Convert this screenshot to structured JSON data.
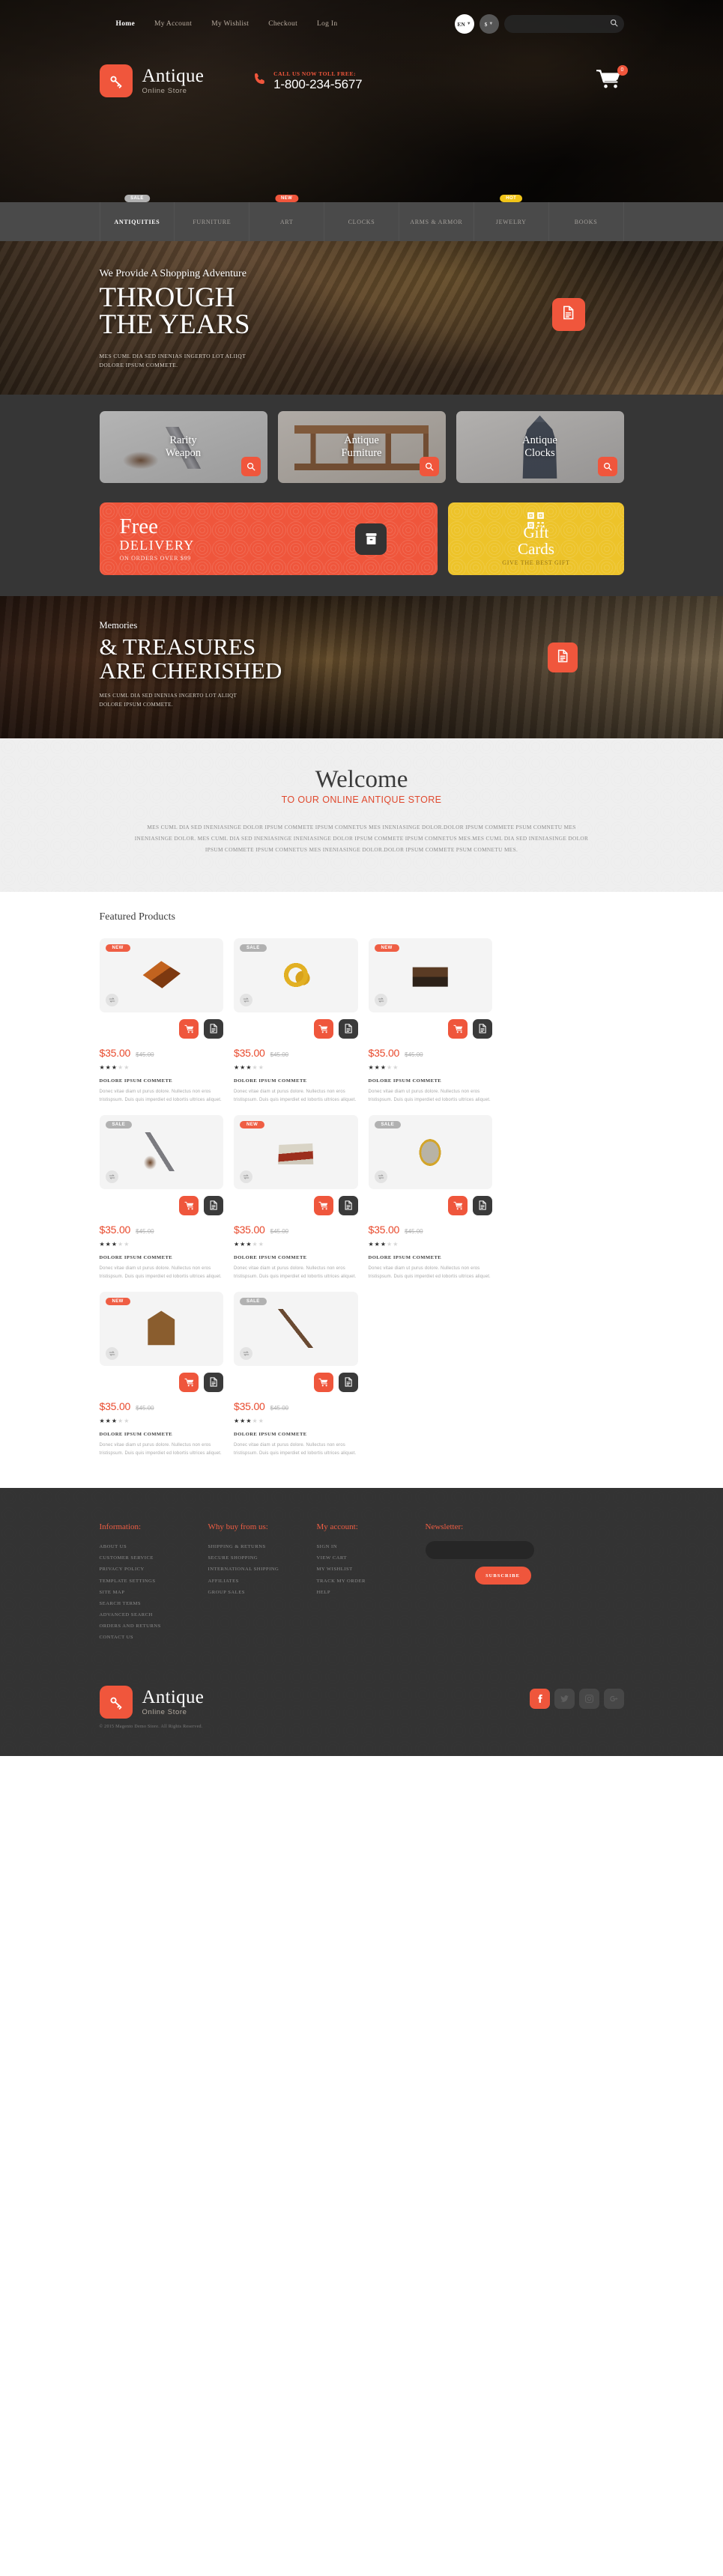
{
  "top_nav": {
    "links": [
      {
        "label": "Home",
        "active": true
      },
      {
        "label": "My Account",
        "active": false
      },
      {
        "label": "My Wishlist",
        "active": false
      },
      {
        "label": "Checkout",
        "active": false
      },
      {
        "label": "Log In",
        "active": false
      }
    ],
    "language": "EN",
    "currency": "$",
    "search_placeholder": "",
    "search_value": ""
  },
  "brand": {
    "name": "Antique",
    "tagline": "Online Store",
    "icon": "key-icon"
  },
  "contact": {
    "call_label": "CALL US NOW TOLL FREE:",
    "phone": "1-800-234-5677",
    "cart_count": "0"
  },
  "main_nav": [
    {
      "label": "ANTIQUITIES",
      "badge": "SALE",
      "badge_type": "sale",
      "active": true
    },
    {
      "label": "FURNITURE",
      "badge": "",
      "badge_type": "",
      "active": false
    },
    {
      "label": "ART",
      "badge": "NEW",
      "badge_type": "new",
      "active": false
    },
    {
      "label": "CLOCKS",
      "badge": "",
      "badge_type": "",
      "active": false
    },
    {
      "label": "ARMS & ARMOR",
      "badge": "",
      "badge_type": "",
      "active": false
    },
    {
      "label": "JEWELRY",
      "badge": "HOT",
      "badge_type": "hot",
      "active": false
    },
    {
      "label": "BOOKS",
      "badge": "",
      "badge_type": "",
      "active": false
    }
  ],
  "slide1": {
    "subtitle": "We Provide A Shopping Adventure",
    "title_line1": "THROUGH",
    "title_line2": "THE YEARS",
    "desc_line1": "MES CUML DIA SED INENIAS INGERTO LOT ALIIQT",
    "desc_line2": "DOLORE IPSUM COMMETE.",
    "button_icon": "document-icon"
  },
  "categories": [
    {
      "line1": "Rarity",
      "line2": "Weapon",
      "icon": "search-icon"
    },
    {
      "line1": "Antique",
      "line2": "Furniture",
      "icon": "search-icon"
    },
    {
      "line1": "Antique",
      "line2": "Clocks",
      "icon": "search-icon"
    }
  ],
  "promos": {
    "free": {
      "big": "Free",
      "mid": "DELIVERY",
      "small": "ON ORDERS OVER $99",
      "icon": "box-icon"
    },
    "gift": {
      "big_line1": "Gift",
      "big_line2": "Cards",
      "small": "GIVE THE BEST GIFT",
      "icon": "qr-code-icon"
    }
  },
  "slide2": {
    "subtitle": "Memories",
    "title_line1": "& TREASURES",
    "title_line2": "ARE CHERISHED",
    "desc_line1": "MES CUML DIA SED INENIAS INGERTO LOT ALIIQT",
    "desc_line2": "DOLORE IPSUM COMMETE.",
    "button_icon": "document-icon"
  },
  "welcome": {
    "title": "Welcome",
    "subtitle": "TO OUR ONLINE ANTIQUE STORE",
    "body": "MES CUML DIA SED INENIASINGE DOLOR IPSUM COMMETE IPSUM COMNETUS MES INENIASINGE DOLOR.DOLOR IPSUM COMMETE PSUM COMNETU MES INENIASINGE DOLOR. MES CUML DIA SED INENIASINGE INENIASINGE DOLOR IPSUM COMMETE IPSUM COMNETUS MES.MES CUML DIA SED INENIASINGE DOLOR IPSUM COMMETE IPSUM COMNETUS MES INENIASINGE DOLOR.DOLOR IPSUM COMMETE PSUM COMNETU MES."
  },
  "featured": {
    "title": "Featured Products",
    "products": [
      {
        "badge": "NEW",
        "badge_type": "new",
        "img": "img-box",
        "price": "$35.00",
        "old_price": "$45.00",
        "stars": 3,
        "name": "DOLORE IPSUM COMMETE",
        "desc": "Donec vitae diam ut purus dolore. Nullectus non eros tristispsum. Duis quis imperdiet ed lobortis ultrices aliquet."
      },
      {
        "badge": "SALE",
        "badge_type": "sale",
        "img": "img-ring",
        "price": "$35.00",
        "old_price": "$45.00",
        "stars": 3,
        "name": "DOLORE IPSUM COMMETE",
        "desc": "Donec vitae diam ut purus dolore. Nullectus non eros tristispsum. Duis quis imperdiet ed lobortis ultrices aliquet."
      },
      {
        "badge": "NEW",
        "badge_type": "new",
        "img": "img-book",
        "price": "$35.00",
        "old_price": "$45.00",
        "stars": 3,
        "name": "DOLORE IPSUM COMMETE",
        "desc": "Donec vitae diam ut purus dolore. Nullectus non eros tristispsum. Duis quis imperdiet ed lobortis ultrices aliquet."
      },
      {
        "badge": "SALE",
        "badge_type": "sale",
        "img": "img-pistol",
        "price": "$35.00",
        "old_price": "$45.00",
        "stars": 3,
        "name": "DOLORE IPSUM COMMETE",
        "desc": "Donec vitae diam ut purus dolore. Nullectus non eros tristispsum. Duis quis imperdiet ed lobortis ultrices aliquet."
      },
      {
        "badge": "NEW",
        "badge_type": "new",
        "img": "img-chest",
        "price": "$35.00",
        "old_price": "$45.00",
        "stars": 3,
        "name": "DOLORE IPSUM COMMETE",
        "desc": "Donec vitae diam ut purus dolore. Nullectus non eros tristispsum. Duis quis imperdiet ed lobortis ultrices aliquet."
      },
      {
        "badge": "SALE",
        "badge_type": "sale",
        "img": "img-mirror",
        "price": "$35.00",
        "old_price": "$45.00",
        "stars": 3,
        "name": "DOLORE IPSUM COMMETE",
        "desc": "Donec vitae diam ut purus dolore. Nullectus non eros tristispsum. Duis quis imperdiet ed lobortis ultrices aliquet."
      },
      {
        "badge": "NEW",
        "badge_type": "new",
        "img": "img-radio",
        "price": "$35.00",
        "old_price": "$45.00",
        "stars": 3,
        "name": "DOLORE IPSUM COMMETE",
        "desc": "Donec vitae diam ut purus dolore. Nullectus non eros tristispsum. Duis quis imperdiet ed lobortis ultrices aliquet."
      },
      {
        "badge": "SALE",
        "badge_type": "sale",
        "img": "img-musket",
        "price": "$35.00",
        "old_price": "$45.00",
        "stars": 3,
        "name": "DOLORE IPSUM COMMETE",
        "desc": "Donec vitae diam ut purus dolore. Nullectus non eros tristispsum. Duis quis imperdiet ed lobortis ultrices aliquet."
      }
    ]
  },
  "footer": {
    "col_information": {
      "title": "Information:",
      "links": [
        "ABOUT US",
        "CUSTOMER SERVICE",
        "PRIVACY POLICY",
        "TEMPLATE SETTINGS",
        "SITE MAP",
        "SEARCH TERMS",
        "ADVANCED SEARCH",
        "ORDERS AND RETURNS",
        "CONTACT US"
      ]
    },
    "col_why": {
      "title": "Why buy from us:",
      "links": [
        "SHIPPING & RETURNS",
        "SECURE SHOPPING",
        "INTERNATIONAL SHIPPING",
        "AFFILIATES",
        "GROUP SALES"
      ]
    },
    "col_account": {
      "title": "My account:",
      "links": [
        "SIGN IN",
        "VIEW CART",
        "MY WISHLIST",
        "TRACK MY ORDER",
        "HELP"
      ]
    },
    "newsletter": {
      "title": "Newsletter:",
      "placeholder": "",
      "value": "",
      "button": "SUBSCRIBE"
    },
    "copyright": "© 2015 Magento Demo Store. All Rights Reserved.",
    "social": [
      {
        "name": "facebook-icon",
        "active": true
      },
      {
        "name": "twitter-icon",
        "active": false
      },
      {
        "name": "instagram-icon",
        "active": false
      },
      {
        "name": "google-plus-icon",
        "active": false
      }
    ]
  },
  "colors": {
    "accent": "#ef563c",
    "yellow": "#edc32a",
    "dark": "#333333",
    "nav_bg": "#4a4a4a"
  }
}
